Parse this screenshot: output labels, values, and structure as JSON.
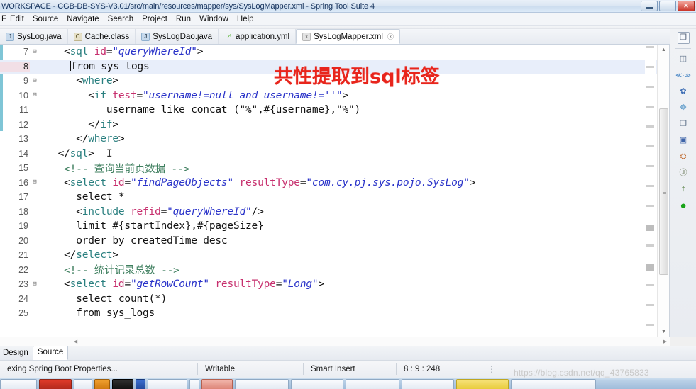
{
  "window": {
    "title": "WORKSPACE - CGB-DB-SYS-V3.01/src/main/resources/mapper/sys/SysLogMapper.xml - Spring Tool Suite 4",
    "minimize_label": "Minimize",
    "restore_label": "Restore",
    "close_label": "✕"
  },
  "menu": {
    "items": [
      {
        "label": "File"
      },
      {
        "label": "Edit"
      },
      {
        "label": "Source"
      },
      {
        "label": "Navigate"
      },
      {
        "label": "Search"
      },
      {
        "label": "Project"
      },
      {
        "label": "Run"
      },
      {
        "label": "Window"
      },
      {
        "label": "Help"
      }
    ]
  },
  "editor_tabs": [
    {
      "label": "SysLog.java",
      "icon": "java-file-icon",
      "icon_glyph": "J",
      "icon_class": "icon-java",
      "active": false,
      "closable": false
    },
    {
      "label": "Cache.class",
      "icon": "class-file-icon",
      "icon_glyph": "C",
      "icon_class": "icon-class",
      "active": false,
      "closable": false
    },
    {
      "label": "SysLogDao.java",
      "icon": "java-file-icon",
      "icon_glyph": "J",
      "icon_class": "icon-java",
      "active": false,
      "closable": false
    },
    {
      "label": "application.yml",
      "icon": "yml-file-icon",
      "icon_glyph": "⎇",
      "icon_class": "icon-yml",
      "active": false,
      "closable": false
    },
    {
      "label": "SysLogMapper.xml",
      "icon": "xml-file-icon",
      "icon_glyph": "x",
      "icon_class": "icon-xml",
      "active": true,
      "closable": true
    }
  ],
  "annotation": {
    "text": "共性提取到sql标签",
    "color": "#e8251c"
  },
  "code": {
    "language": "xml",
    "current_line": 8,
    "lines": [
      {
        "num": "7",
        "fold": "⊟",
        "indent": 4,
        "tokens": [
          {
            "t": "punct",
            "v": "<"
          },
          {
            "t": "tagname",
            "v": "sql"
          },
          {
            "t": "plain",
            "v": " "
          },
          {
            "t": "attrname",
            "v": "id"
          },
          {
            "t": "punct",
            "v": "="
          },
          {
            "t": "attrval",
            "v": "\"queryWhereId\""
          },
          {
            "t": "punct",
            "v": ">"
          }
        ]
      },
      {
        "num": "8",
        "fold": "",
        "indent": 5,
        "caret": true,
        "tokens": [
          {
            "t": "plain",
            "v": "from sys_logs"
          }
        ]
      },
      {
        "num": "9",
        "fold": "⊟",
        "indent": 6,
        "tokens": [
          {
            "t": "punct",
            "v": "<"
          },
          {
            "t": "tagname",
            "v": "where"
          },
          {
            "t": "punct",
            "v": ">"
          }
        ]
      },
      {
        "num": "10",
        "fold": "⊟",
        "indent": 8,
        "tokens": [
          {
            "t": "punct",
            "v": "<"
          },
          {
            "t": "tagname",
            "v": "if"
          },
          {
            "t": "plain",
            "v": " "
          },
          {
            "t": "attrname",
            "v": "test"
          },
          {
            "t": "punct",
            "v": "="
          },
          {
            "t": "attrval",
            "v": "\"username!=null and username!=''\""
          },
          {
            "t": "punct",
            "v": ">"
          }
        ]
      },
      {
        "num": "11",
        "fold": "",
        "indent": 11,
        "tokens": [
          {
            "t": "plain",
            "v": "username like concat (\"%\",#{username},\"%\")"
          }
        ]
      },
      {
        "num": "12",
        "fold": "",
        "indent": 8,
        "tokens": [
          {
            "t": "punct",
            "v": "</"
          },
          {
            "t": "tagname",
            "v": "if"
          },
          {
            "t": "punct",
            "v": ">"
          }
        ]
      },
      {
        "num": "13",
        "fold": "",
        "indent": 6,
        "tokens": [
          {
            "t": "punct",
            "v": "</"
          },
          {
            "t": "tagname",
            "v": "where"
          },
          {
            "t": "punct",
            "v": ">"
          }
        ]
      },
      {
        "num": "14",
        "fold": "",
        "indent": 3,
        "imark": true,
        "tokens": [
          {
            "t": "punct",
            "v": "</"
          },
          {
            "t": "tagname",
            "v": "sql"
          },
          {
            "t": "punct",
            "v": ">"
          }
        ]
      },
      {
        "num": "15",
        "fold": "",
        "indent": 4,
        "tokens": [
          {
            "t": "comment",
            "v": "<!-- 查询当前页数据 -->"
          }
        ]
      },
      {
        "num": "16",
        "fold": "⊟",
        "indent": 4,
        "tokens": [
          {
            "t": "punct",
            "v": "<"
          },
          {
            "t": "tagname",
            "v": "select"
          },
          {
            "t": "plain",
            "v": " "
          },
          {
            "t": "attrname",
            "v": "id"
          },
          {
            "t": "punct",
            "v": "="
          },
          {
            "t": "attrval",
            "v": "\"findPageObjects\""
          },
          {
            "t": "plain",
            "v": " "
          },
          {
            "t": "attrname",
            "v": "resultType"
          },
          {
            "t": "punct",
            "v": "="
          },
          {
            "t": "attrval",
            "v": "\"com.cy.pj.sys.pojo.SysLog\""
          },
          {
            "t": "punct",
            "v": ">"
          }
        ]
      },
      {
        "num": "17",
        "fold": "",
        "indent": 6,
        "tokens": [
          {
            "t": "plain",
            "v": "select *"
          }
        ]
      },
      {
        "num": "18",
        "fold": "",
        "indent": 6,
        "tokens": [
          {
            "t": "punct",
            "v": "<"
          },
          {
            "t": "tagname",
            "v": "include"
          },
          {
            "t": "plain",
            "v": " "
          },
          {
            "t": "attrname",
            "v": "refid"
          },
          {
            "t": "punct",
            "v": "="
          },
          {
            "t": "attrval",
            "v": "\"queryWhereId\""
          },
          {
            "t": "punct",
            "v": "/>"
          }
        ]
      },
      {
        "num": "19",
        "fold": "",
        "indent": 6,
        "tokens": [
          {
            "t": "plain",
            "v": "limit #{startIndex},#{pageSize}"
          }
        ]
      },
      {
        "num": "20",
        "fold": "",
        "indent": 6,
        "tokens": [
          {
            "t": "plain",
            "v": "order by createdTime desc"
          }
        ]
      },
      {
        "num": "21",
        "fold": "",
        "indent": 4,
        "tokens": [
          {
            "t": "punct",
            "v": "</"
          },
          {
            "t": "tagname",
            "v": "select"
          },
          {
            "t": "punct",
            "v": ">"
          }
        ]
      },
      {
        "num": "22",
        "fold": "",
        "indent": 4,
        "tokens": [
          {
            "t": "comment",
            "v": "<!-- 统计记录总数 -->"
          }
        ]
      },
      {
        "num": "23",
        "fold": "⊟",
        "indent": 4,
        "tokens": [
          {
            "t": "punct",
            "v": "<"
          },
          {
            "t": "tagname",
            "v": "select"
          },
          {
            "t": "plain",
            "v": " "
          },
          {
            "t": "attrname",
            "v": "id"
          },
          {
            "t": "punct",
            "v": "="
          },
          {
            "t": "attrval",
            "v": "\"getRowCount\""
          },
          {
            "t": "plain",
            "v": " "
          },
          {
            "t": "attrname",
            "v": "resultType"
          },
          {
            "t": "punct",
            "v": "="
          },
          {
            "t": "attrval",
            "v": "\"Long\""
          },
          {
            "t": "punct",
            "v": ">"
          }
        ]
      },
      {
        "num": "24",
        "fold": "",
        "indent": 6,
        "tokens": [
          {
            "t": "plain",
            "v": "select count(*)"
          }
        ]
      },
      {
        "num": "25",
        "fold": "",
        "indent": 6,
        "tokens": [
          {
            "t": "plain",
            "v": "from sys_logs"
          }
        ]
      }
    ]
  },
  "right_strip": {
    "icons": [
      {
        "name": "restore-perspective-icon",
        "glyph": "❐"
      },
      {
        "name": "open-perspective-icon",
        "glyph": "◫"
      },
      {
        "name": "boot-dashboard-icon",
        "glyph": "≪·≫"
      },
      {
        "name": "spring-explorer-icon",
        "glyph": "✿"
      },
      {
        "name": "debug-perspective-icon",
        "glyph": "☸"
      },
      {
        "name": "java-perspective-icon",
        "glyph": "❐"
      },
      {
        "name": "java-ee-perspective-icon",
        "glyph": "▣"
      },
      {
        "name": "team-sync-icon",
        "glyph": "⛭"
      },
      {
        "name": "javascript-perspective-icon",
        "glyph": "Ⓙ"
      },
      {
        "name": "install-icon",
        "glyph": "⤒"
      },
      {
        "name": "run-icon",
        "glyph": "●"
      }
    ]
  },
  "design_source": {
    "tabs": [
      {
        "label": "Design",
        "active": false
      },
      {
        "label": "Source",
        "active": true
      }
    ]
  },
  "status_bar": {
    "task": "exing Spring Boot Properties...",
    "writable": "Writable",
    "insert_mode": "Smart Insert",
    "position": "8 : 9 : 248",
    "overflow": "⋮"
  },
  "watermark": {
    "text": "https://blog.csdn.net/qq_43765833"
  }
}
